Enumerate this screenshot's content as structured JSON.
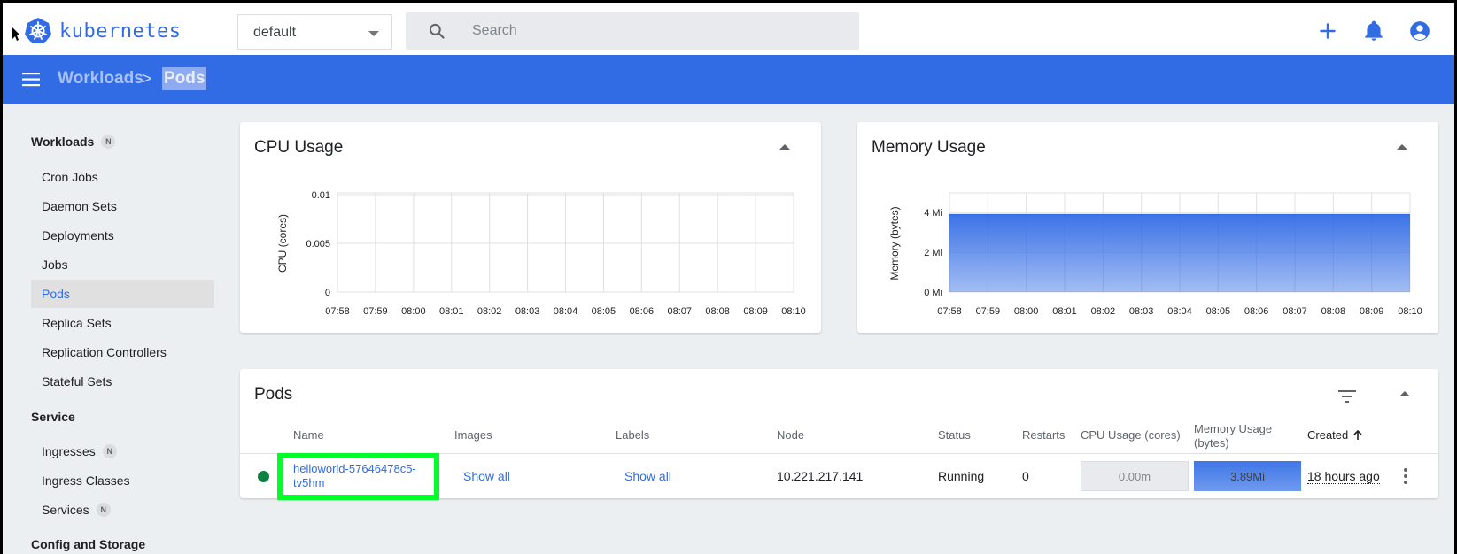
{
  "app": {
    "logo_text": "kubernetes"
  },
  "namespace": {
    "selected": "default"
  },
  "search": {
    "placeholder": "Search"
  },
  "breadcrumb": {
    "parent": "Workloads",
    "current": "Pods",
    "separator": ">"
  },
  "sidebar": {
    "sections": [
      {
        "title": "Workloads",
        "badge": "N"
      },
      {
        "title": "Service",
        "badge": ""
      },
      {
        "title": "Config and Storage",
        "badge": ""
      }
    ],
    "items": [
      {
        "label": "Cron Jobs",
        "badge": ""
      },
      {
        "label": "Daemon Sets",
        "badge": ""
      },
      {
        "label": "Deployments",
        "badge": ""
      },
      {
        "label": "Jobs",
        "badge": ""
      },
      {
        "label": "Pods",
        "badge": "",
        "active": true
      },
      {
        "label": "Replica Sets",
        "badge": ""
      },
      {
        "label": "Replication Controllers",
        "badge": ""
      },
      {
        "label": "Stateful Sets",
        "badge": ""
      },
      {
        "label": "Ingresses",
        "badge": "N"
      },
      {
        "label": "Ingress Classes",
        "badge": ""
      },
      {
        "label": "Services",
        "badge": "N"
      }
    ]
  },
  "chart_data": [
    {
      "type": "line",
      "title": "CPU Usage",
      "ylabel": "CPU (cores)",
      "x": [
        "07:58",
        "07:59",
        "08:00",
        "08:01",
        "08:02",
        "08:03",
        "08:04",
        "08:05",
        "08:06",
        "08:07",
        "08:08",
        "08:09",
        "08:10"
      ],
      "yticks": [
        "0",
        "0.005",
        "0.01"
      ],
      "ylim": [
        0,
        0.01
      ],
      "series": [
        {
          "values": [
            0,
            0,
            0,
            0,
            0,
            0,
            0,
            0,
            0,
            0,
            0,
            0,
            0
          ]
        }
      ],
      "grid": true
    },
    {
      "type": "area",
      "title": "Memory Usage",
      "ylabel": "Memory (bytes)",
      "x": [
        "07:58",
        "07:59",
        "08:00",
        "08:01",
        "08:02",
        "08:03",
        "08:04",
        "08:05",
        "08:06",
        "08:07",
        "08:08",
        "08:09",
        "08:10"
      ],
      "yticks": [
        "0 Mi",
        "2 Mi",
        "4 Mi"
      ],
      "ylim": [
        0,
        4.9
      ],
      "series": [
        {
          "values": [
            3.89,
            3.89,
            3.89,
            3.89,
            3.89,
            3.89,
            3.89,
            3.89,
            3.89,
            3.89,
            3.89,
            3.89,
            3.89
          ]
        }
      ],
      "grid": true,
      "color": "#326ce5"
    }
  ],
  "pods_table": {
    "title": "Pods",
    "columns": [
      "Name",
      "Images",
      "Labels",
      "Node",
      "Status",
      "Restarts",
      "CPU Usage (cores)",
      "Memory Usage",
      "(bytes)",
      "Created"
    ],
    "rows": [
      {
        "status_color": "#0b8043",
        "name_line1": "helloworld-57646478c5-",
        "name_line2": "tv5hm",
        "images": "Show all",
        "labels": "Show all",
        "node": "10.221.217.141",
        "status": "Running",
        "restarts": "0",
        "cpu": "0.00m",
        "memory": "3.89Mi",
        "created": "18 hours ago"
      }
    ]
  },
  "colors": {
    "accent": "#326ce5",
    "highlight": "#00ff2a",
    "running": "#0b8043"
  }
}
